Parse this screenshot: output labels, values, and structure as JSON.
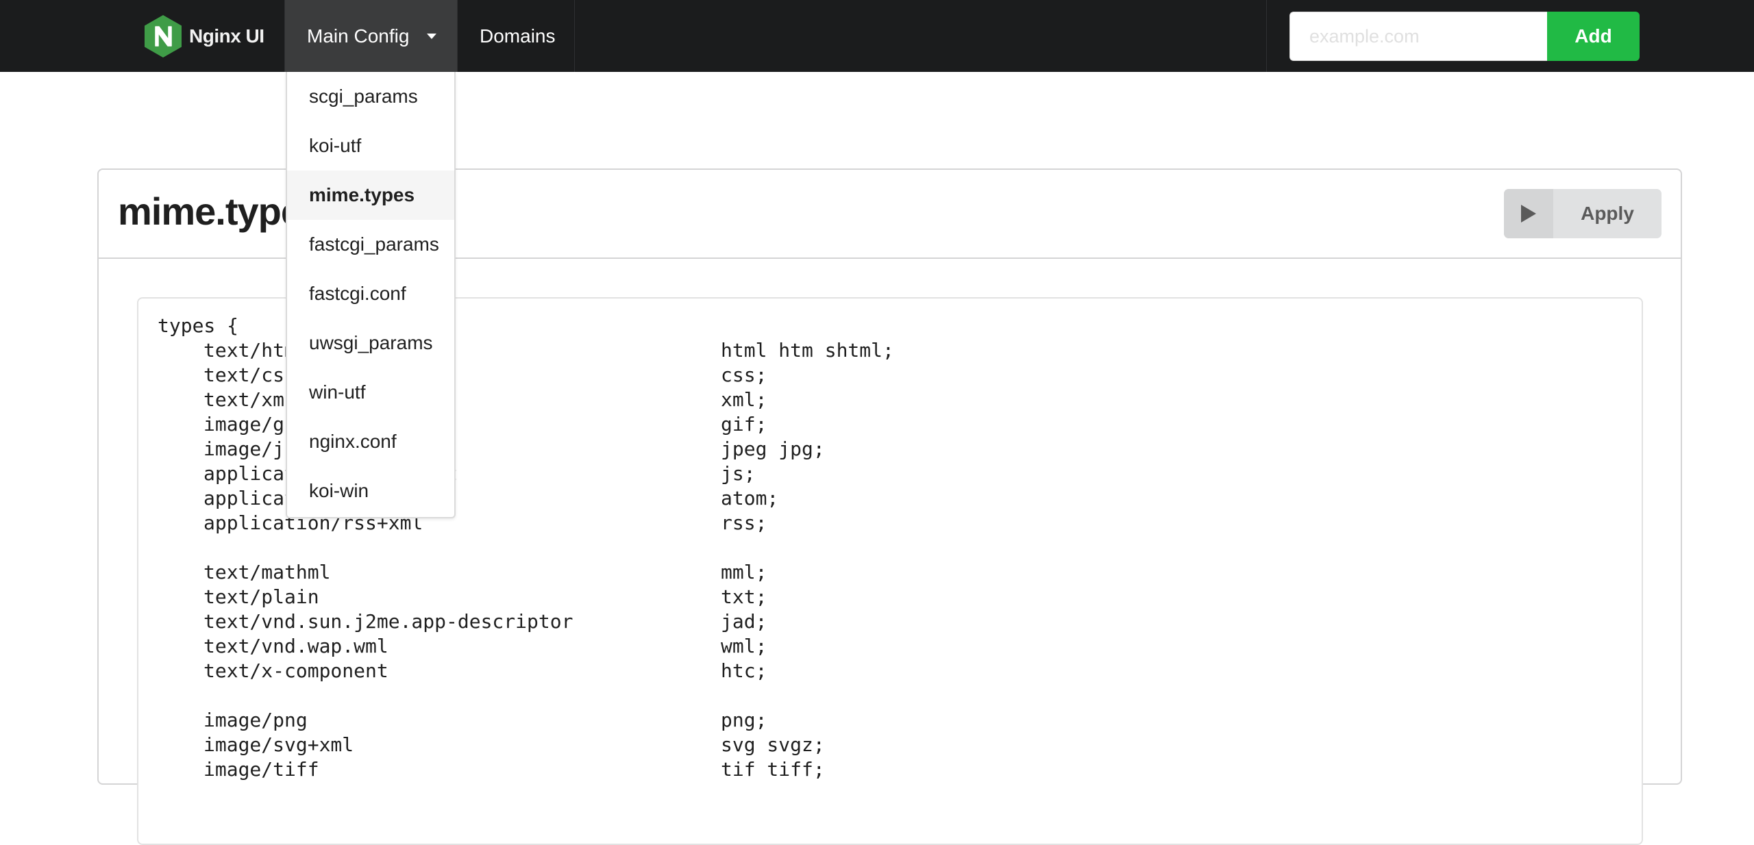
{
  "navbar": {
    "brand": "Nginx UI",
    "logo_icon": "nginx-hexagon-logo",
    "menu": [
      {
        "label": "Main Config",
        "has_dropdown": true,
        "active": true
      },
      {
        "label": "Domains",
        "has_dropdown": false,
        "active": false
      }
    ],
    "add_domain": {
      "placeholder": "example.com",
      "value": "",
      "button_label": "Add"
    }
  },
  "dropdown": {
    "items": [
      {
        "label": "scgi_params",
        "active": false
      },
      {
        "label": "koi-utf",
        "active": false
      },
      {
        "label": "mime.types",
        "active": true
      },
      {
        "label": "fastcgi_params",
        "active": false
      },
      {
        "label": "fastcgi.conf",
        "active": false
      },
      {
        "label": "uwsgi_params",
        "active": false
      },
      {
        "label": "win-utf",
        "active": false
      },
      {
        "label": "nginx.conf",
        "active": false
      },
      {
        "label": "koi-win",
        "active": false
      }
    ]
  },
  "editor": {
    "title": "mime.types",
    "apply_label": "Apply",
    "apply_icon": "play-icon",
    "code_open": "types {",
    "lines": [
      {
        "key": "text/html",
        "value": "html htm shtml;"
      },
      {
        "key": "text/css",
        "value": "css;"
      },
      {
        "key": "text/xml",
        "value": "xml;"
      },
      {
        "key": "image/gif",
        "value": "gif;"
      },
      {
        "key": "image/jpeg",
        "value": "jpeg jpg;"
      },
      {
        "key": "application/javascript",
        "value": "js;"
      },
      {
        "key": "application/atom+xml",
        "value": "atom;"
      },
      {
        "key": "application/rss+xml",
        "value": "rss;"
      },
      {
        "key": "",
        "value": ""
      },
      {
        "key": "text/mathml",
        "value": "mml;"
      },
      {
        "key": "text/plain",
        "value": "txt;"
      },
      {
        "key": "text/vnd.sun.j2me.app-descriptor",
        "value": "jad;"
      },
      {
        "key": "text/vnd.wap.wml",
        "value": "wml;"
      },
      {
        "key": "text/x-component",
        "value": "htc;"
      },
      {
        "key": "",
        "value": ""
      },
      {
        "key": "image/png",
        "value": "png;"
      },
      {
        "key": "image/svg+xml",
        "value": "svg svgz;"
      },
      {
        "key": "image/tiff",
        "value": "tif tiff;"
      }
    ]
  },
  "colors": {
    "navbar_bg": "#1b1c1d",
    "active_nav_bg": "#3b3c3d",
    "add_button": "#21ba45",
    "logo_green": "#3f9c47",
    "apply_bg": "#e0e1e2"
  }
}
